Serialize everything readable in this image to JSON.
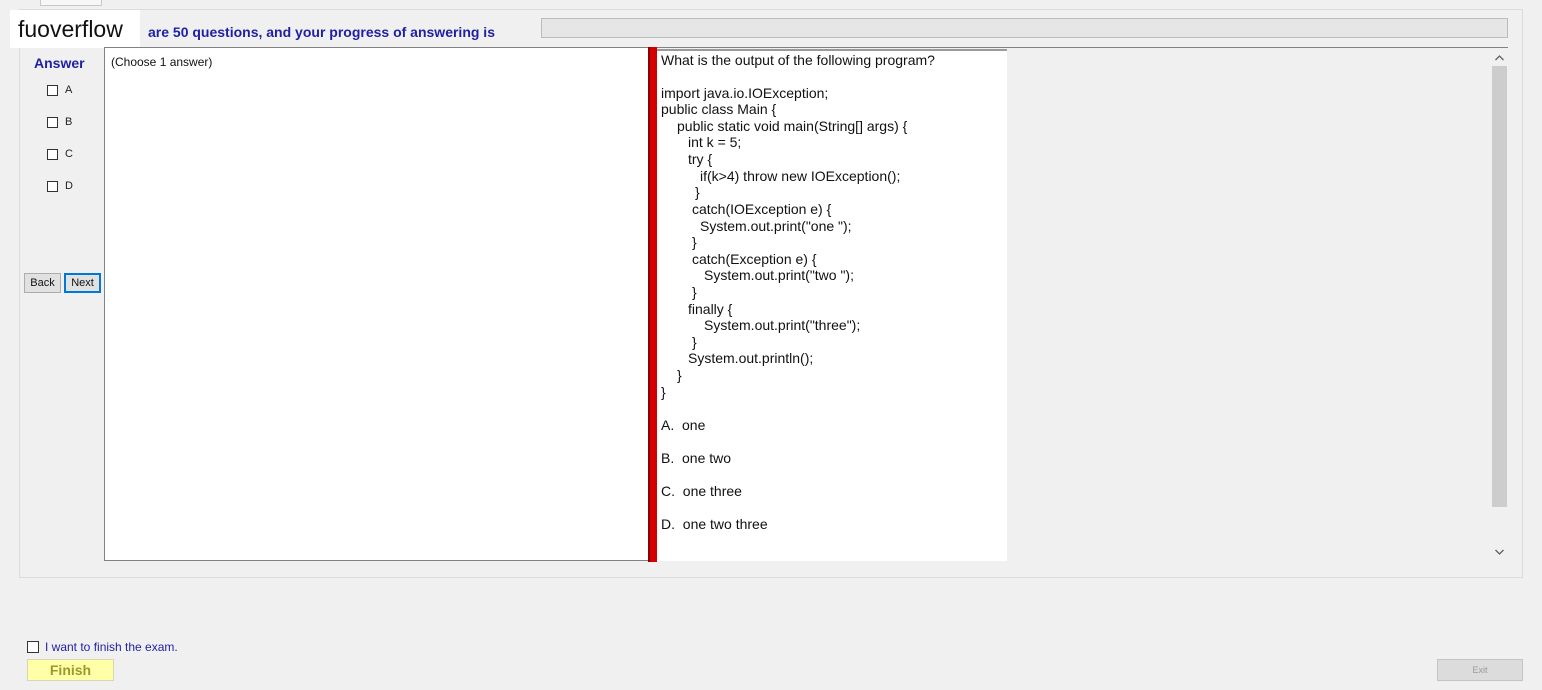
{
  "watermark": "fuoverflow",
  "header": {
    "progress_label": "are 50 questions, and your progress of answering is",
    "progress_fraction": 0.0
  },
  "answer_panel": {
    "title": "Answer",
    "options": [
      "A",
      "B",
      "C",
      "D"
    ],
    "back_label": "Back",
    "next_label": "Next"
  },
  "answer_area": {
    "hint": "(Choose 1 answer)"
  },
  "question": {
    "prompt": "What is the output of the following program?",
    "code": [
      "import java.io.IOException;",
      "public class Main {",
      "public static void main(String[] args) {",
      "int k = 5;",
      "try {",
      "if(k>4) throw new IOException();",
      "}",
      "catch(IOException e) {",
      "System.out.print(\"one \");",
      "}",
      "catch(Exception e) {",
      "System.out.print(\"two \");",
      "}",
      "finally {",
      "System.out.print(\"three\");",
      "}",
      "System.out.println();",
      "}",
      "}"
    ],
    "choices": [
      "A.  one",
      "B.  one two",
      "C.  one three",
      "D.  one two three"
    ]
  },
  "footer": {
    "finish_checkbox_label": "I want to finish the exam.",
    "finish_label": "Finish",
    "exit_label": "Exit"
  },
  "colors": {
    "accent_text": "#1f1fa5",
    "splitter": "#d40000",
    "finish_bg": "#ffffa8"
  },
  "icons": {
    "scroll_up": "chevron-up-icon",
    "scroll_down": "chevron-down-icon"
  }
}
